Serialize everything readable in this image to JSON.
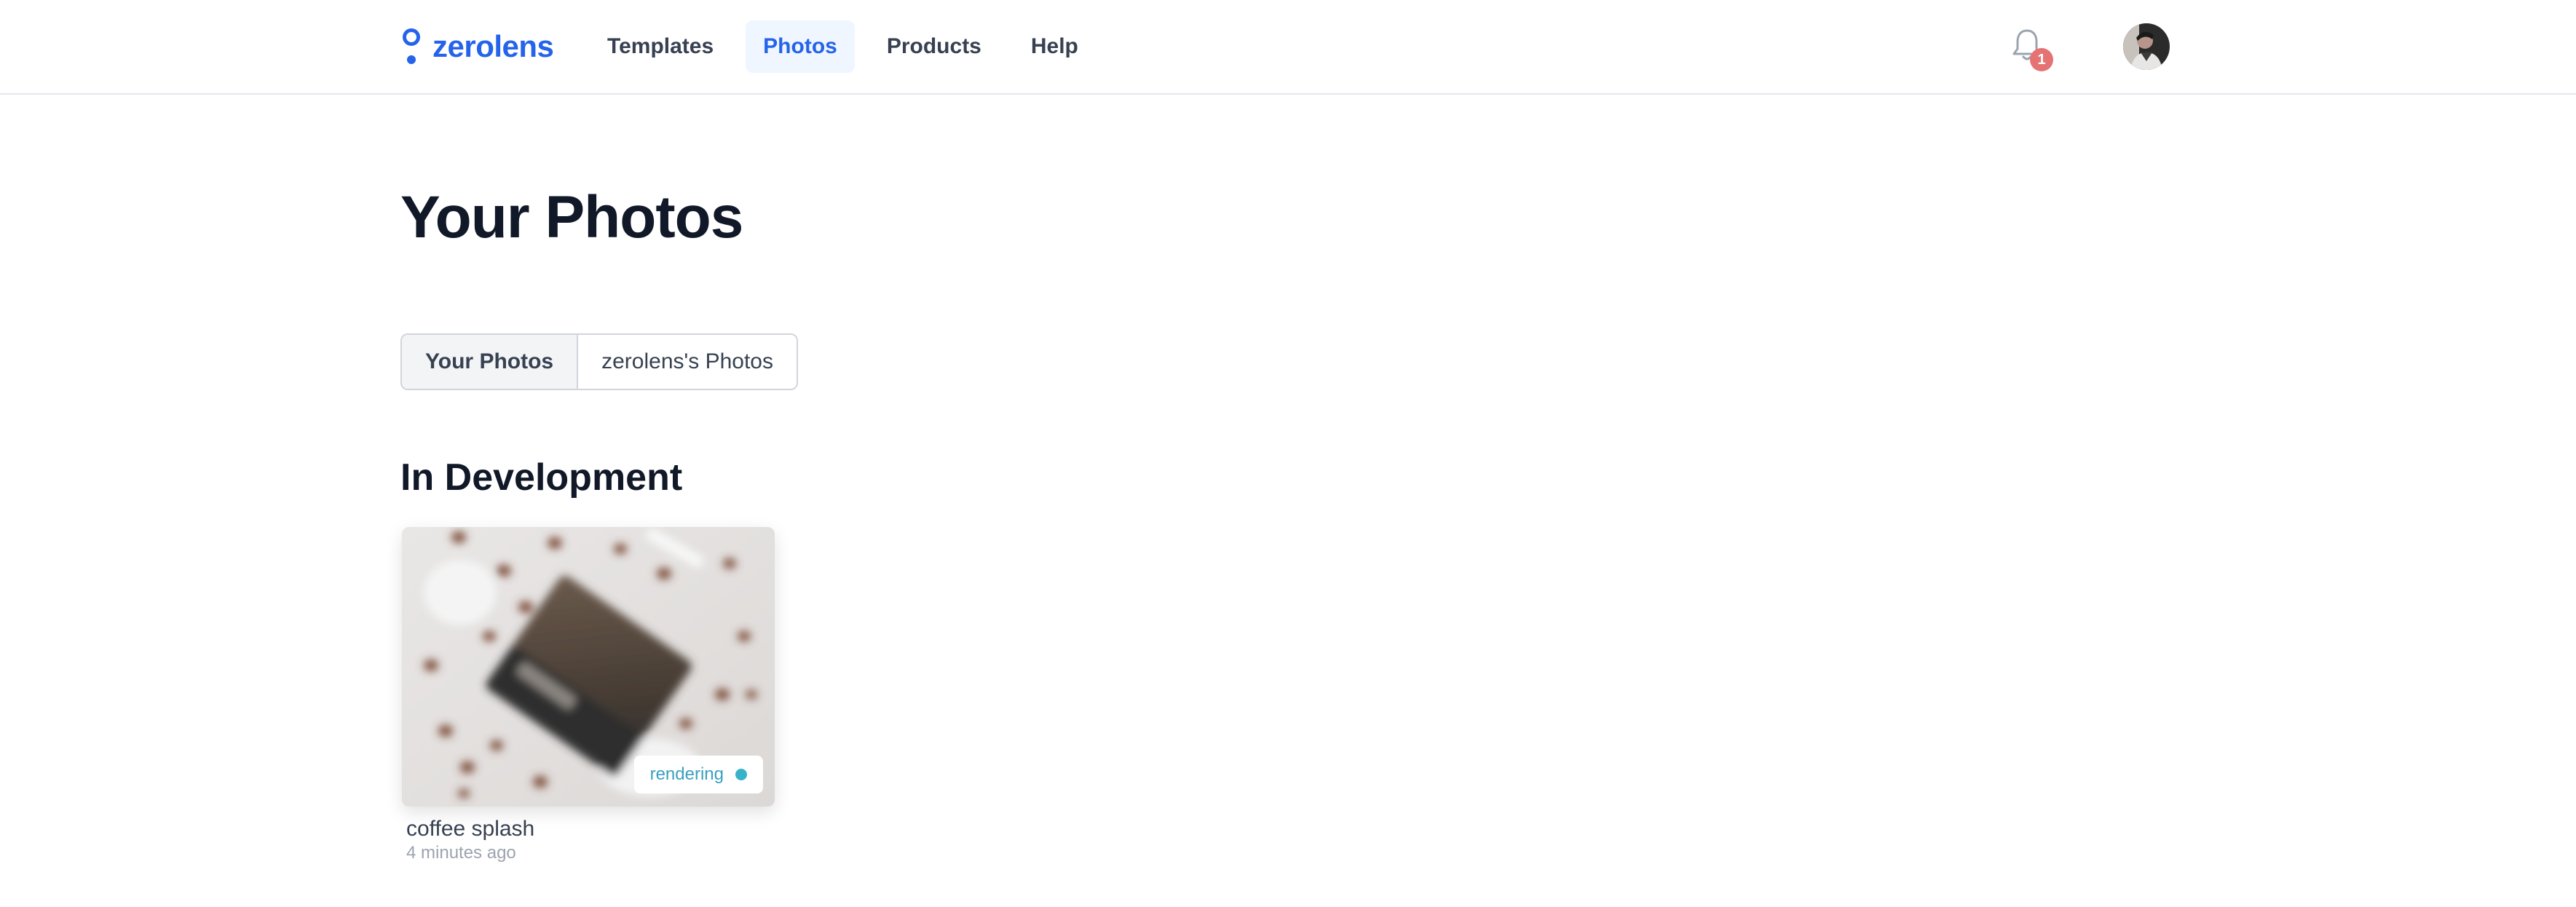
{
  "header": {
    "brand": "zerolens",
    "nav": [
      {
        "label": "Templates"
      },
      {
        "label": "Photos"
      },
      {
        "label": "Products"
      },
      {
        "label": "Help"
      }
    ],
    "notifications_count": "1"
  },
  "page": {
    "title": "Your Photos"
  },
  "tabs": [
    {
      "label": "Your Photos"
    },
    {
      "label": "zerolens's Photos"
    }
  ],
  "section": {
    "title": "In Development"
  },
  "photos": [
    {
      "name": "coffee splash",
      "time": "4 minutes ago",
      "status": "rendering"
    }
  ],
  "colors": {
    "brand": "#2563eb",
    "active_nav_bg": "#eff6ff",
    "badge": "#e57373",
    "status": "#38b2c9"
  },
  "icons": {
    "logo": "pin-logo-icon",
    "notifications": "bell-icon",
    "status": "status-dot-icon"
  }
}
